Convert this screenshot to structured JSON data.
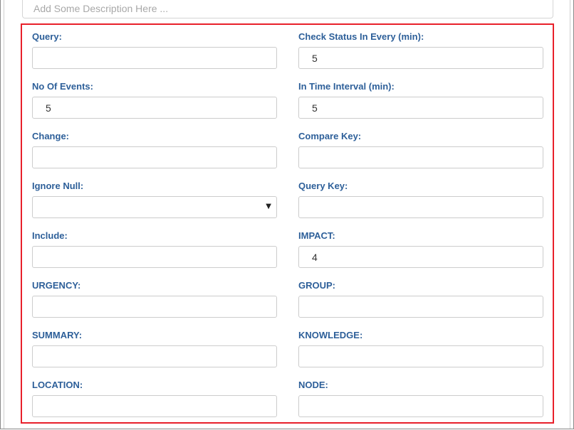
{
  "description": {
    "placeholder": "Add Some Description Here ...",
    "value": ""
  },
  "form": {
    "query": {
      "label": "Query:",
      "value": ""
    },
    "check_status": {
      "label": "Check Status In Every (min):",
      "value": "5"
    },
    "no_of_events": {
      "label": "No Of Events:",
      "value": "5"
    },
    "time_interval": {
      "label": "In Time Interval (min):",
      "value": "5"
    },
    "change": {
      "label": "Change:",
      "value": ""
    },
    "compare_key": {
      "label": "Compare Key:",
      "value": ""
    },
    "ignore_null": {
      "label": "Ignore Null:",
      "selected": ""
    },
    "query_key": {
      "label": "Query Key:",
      "value": ""
    },
    "include": {
      "label": "Include:",
      "value": ""
    },
    "impact": {
      "label": "IMPACT:",
      "value": "4"
    },
    "urgency": {
      "label": "URGENCY:",
      "value": ""
    },
    "group": {
      "label": "GROUP:",
      "value": ""
    },
    "summary": {
      "label": "SUMMARY:",
      "value": ""
    },
    "knowledge": {
      "label": "KNOWLEDGE:",
      "value": ""
    },
    "location": {
      "label": "LOCATION:",
      "value": ""
    },
    "node": {
      "label": "NODE:",
      "value": ""
    }
  },
  "icons": {
    "dropdown": "caret-down-icon"
  },
  "colors": {
    "label": "#2d5f99",
    "highlight_border": "#e8202a"
  }
}
